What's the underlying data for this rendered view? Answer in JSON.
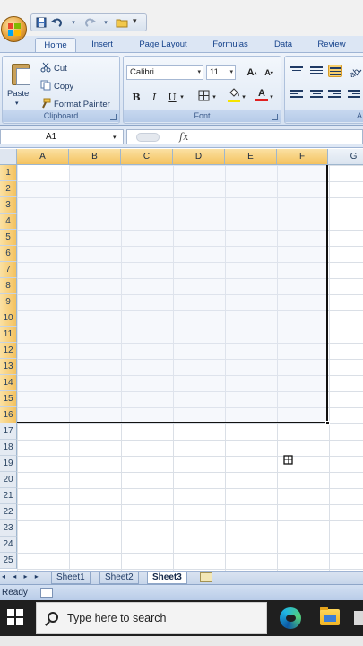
{
  "qat": {
    "more_glyph": "▾"
  },
  "tabs": [
    {
      "label": "Home",
      "active": true
    },
    {
      "label": "Insert"
    },
    {
      "label": "Page Layout"
    },
    {
      "label": "Formulas"
    },
    {
      "label": "Data"
    },
    {
      "label": "Review"
    }
  ],
  "clipboard": {
    "paste_label": "Paste",
    "cut_label": "Cut",
    "copy_label": "Copy",
    "format_painter_label": "Format Painter",
    "group_label": "Clipboard"
  },
  "font": {
    "family": "Calibri",
    "size": "11",
    "bold": "B",
    "italic": "I",
    "underline": "U",
    "grow": "A",
    "shrink": "A",
    "color_letter": "A",
    "group_label": "Font",
    "highlight_color": "#f5e400",
    "font_color": "#e02020"
  },
  "alignment": {
    "group_label": "A"
  },
  "formula_bar": {
    "name_box": "A1",
    "fx": "fx",
    "content": ""
  },
  "grid": {
    "columns": [
      "A",
      "B",
      "C",
      "D",
      "E",
      "F",
      "G"
    ],
    "selected_columns": [
      "A",
      "B",
      "C",
      "D",
      "E",
      "F"
    ],
    "rows": [
      "1",
      "2",
      "3",
      "4",
      "5",
      "6",
      "7",
      "8",
      "9",
      "10",
      "11",
      "12",
      "13",
      "14",
      "15",
      "16",
      "17",
      "18",
      "19",
      "20",
      "21",
      "22",
      "23",
      "24",
      "25"
    ],
    "selected_rows_count": 16,
    "selected_range": "A1:F16"
  },
  "sheets": [
    {
      "label": "Sheet1"
    },
    {
      "label": "Sheet2"
    },
    {
      "label": "Sheet3",
      "active": true
    }
  ],
  "sheet_nav": "◂ ◂ ▸ ▸",
  "status": {
    "text": "Ready"
  },
  "taskbar": {
    "search_placeholder": "Type here to search"
  },
  "colors": {
    "ribbon": "#dce6f4",
    "selection_header": "#f4c25f",
    "taskbar": "#1f1f1f"
  }
}
